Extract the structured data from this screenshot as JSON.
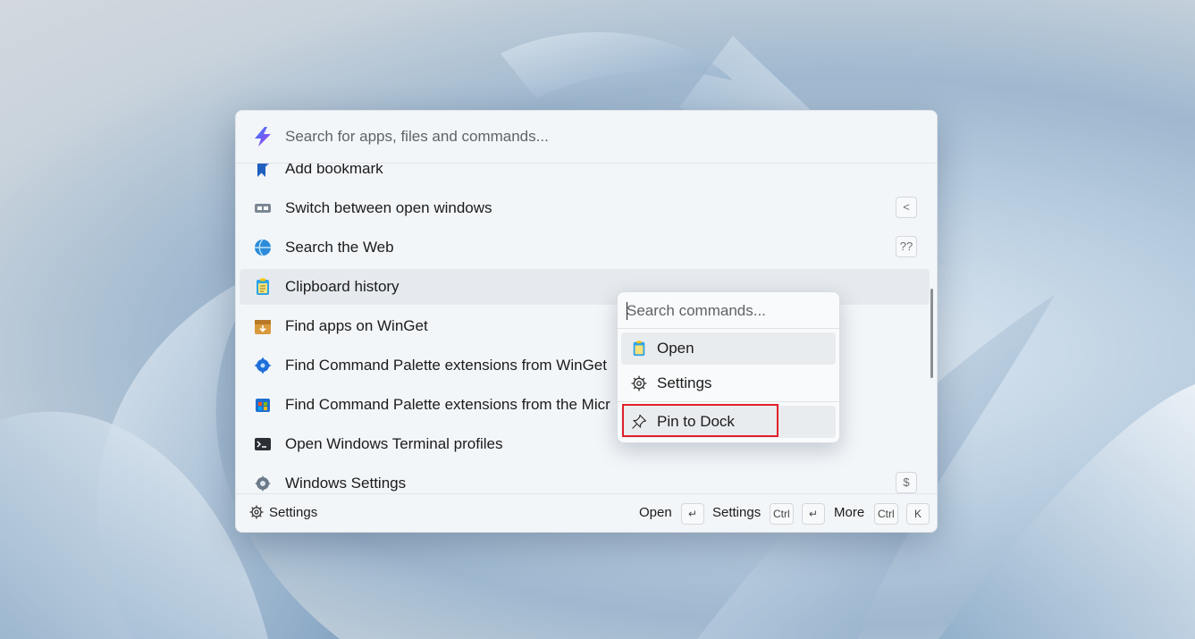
{
  "search": {
    "placeholder": "Search for apps, files and commands..."
  },
  "list": {
    "items": [
      {
        "label": "Add bookmark",
        "icon": "bookmark-add-icon",
        "shortcut": ""
      },
      {
        "label": "Switch between open windows",
        "icon": "windows-switch-icon",
        "shortcut": "<"
      },
      {
        "label": "Search the Web",
        "icon": "web-search-icon",
        "shortcut": "??"
      },
      {
        "label": "Clipboard history",
        "icon": "clipboard-icon",
        "shortcut": "",
        "selected": true
      },
      {
        "label": "Find apps on WinGet",
        "icon": "winget-package-icon",
        "shortcut": ""
      },
      {
        "label": "Find Command Palette extensions from WinGet",
        "icon": "extension-gear-icon",
        "shortcut": ""
      },
      {
        "label": "Find Command Palette extensions from the Micr",
        "icon": "store-icon",
        "shortcut": ""
      },
      {
        "label": "Open Windows Terminal profiles",
        "icon": "terminal-icon",
        "shortcut": ""
      },
      {
        "label": "Windows Settings",
        "icon": "settings-icon",
        "shortcut": "$"
      }
    ]
  },
  "footer": {
    "settings_label": "Settings",
    "open_label": "Open",
    "open_key": "↵",
    "settings_hint_label": "Settings",
    "settings_key1": "Ctrl",
    "settings_key2": "↵",
    "more_label": "More",
    "more_key1": "Ctrl",
    "more_key2": "K"
  },
  "context_menu": {
    "search_placeholder": "Search commands...",
    "items": [
      {
        "label": "Open",
        "icon": "clipboard-icon"
      },
      {
        "label": "Settings",
        "icon": "gear-icon"
      },
      {
        "label": "Pin to Dock",
        "icon": "pin-icon",
        "highlighted": true
      }
    ]
  },
  "colors": {
    "accent_red": "#e0202a",
    "selected_bg": "#e6eaee",
    "panel_bg": "#f3f6f9"
  }
}
